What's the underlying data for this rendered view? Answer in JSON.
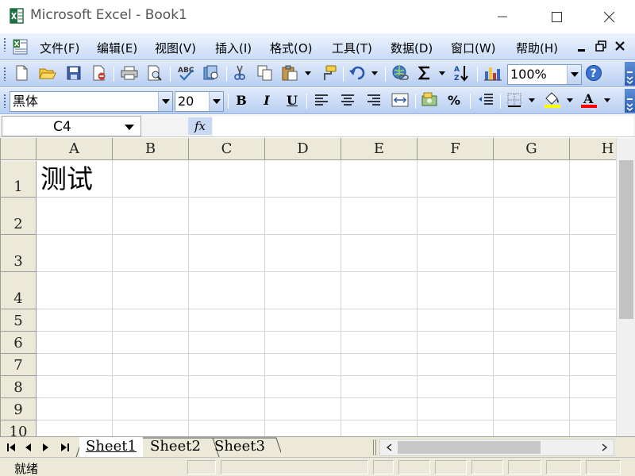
{
  "window": {
    "title": "Microsoft Excel - Book1",
    "minimize_icon": "minimize-icon",
    "maximize_icon": "maximize-icon",
    "close_icon": "close-icon"
  },
  "menubar": {
    "items": [
      "文件(F)",
      "编辑(E)",
      "视图(V)",
      "插入(I)",
      "格式(O)",
      "工具(T)",
      "数据(D)",
      "窗口(W)",
      "帮助(H)"
    ],
    "right_icons": [
      "minimize-icon",
      "restore-icon",
      "close-icon"
    ]
  },
  "standard_toolbar": {
    "zoom": "100%",
    "icons": [
      "new-icon",
      "open-icon",
      "save-icon",
      "permission-icon",
      "print-icon",
      "print-preview-icon",
      "spelling-icon",
      "research-icon",
      "cut-icon",
      "copy-icon",
      "paste-icon",
      "format-painter-icon",
      "undo-icon",
      "hyperlink-icon",
      "autosum-icon",
      "sort-icon",
      "chart-wizard-icon",
      "help-icon"
    ]
  },
  "formatting_toolbar": {
    "font_name": "黑体",
    "font_size": "20",
    "bold_label": "B",
    "italic_label": "I",
    "underline_label": "U",
    "percent_label": "%",
    "fill_color": "#ffff00",
    "font_color": "#ff0000",
    "icons": [
      "align-left-icon",
      "center-icon",
      "align-right-icon",
      "merge-center-icon",
      "currency-icon",
      "percent-icon",
      "decrease-indent-icon",
      "borders-icon",
      "fill-color-icon",
      "font-color-icon"
    ]
  },
  "formula_bar": {
    "name_box": "C4",
    "fx_label": "fx",
    "formula": ""
  },
  "sheet": {
    "columns": [
      "A",
      "B",
      "C",
      "D",
      "E",
      "F",
      "G",
      "H"
    ],
    "rows": [
      "1",
      "2",
      "3",
      "4",
      "5",
      "6",
      "7",
      "8",
      "9",
      "10"
    ],
    "cells": {
      "A1": "测试"
    }
  },
  "tabs": [
    "Sheet1",
    "Sheet2",
    "Sheet3"
  ],
  "active_tab": "Sheet1",
  "status": {
    "text": "就绪"
  }
}
